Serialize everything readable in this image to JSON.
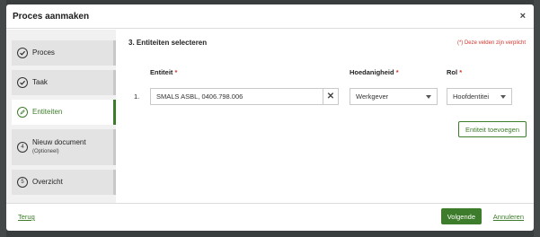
{
  "modal": {
    "title": "Proces aanmaken",
    "close_glyph": "×"
  },
  "sidebar": {
    "steps": [
      {
        "label": "Proces",
        "state": "done",
        "icon": "check-icon"
      },
      {
        "label": "Taak",
        "state": "done",
        "icon": "check-icon"
      },
      {
        "label": "Entiteiten",
        "state": "active",
        "icon": "pencil-icon"
      },
      {
        "label": "Nieuw document",
        "sub": "(Optioneel)",
        "number": "4",
        "state": "todo"
      },
      {
        "label": "Overzicht",
        "number": "5",
        "state": "todo"
      }
    ]
  },
  "content": {
    "section_title": "3. Entiteiten selecteren",
    "required_note": "(*) Deze velden zijn verplicht",
    "columns": {
      "entity": "Entiteit",
      "role_type": "Hoedanigheid",
      "role": "Rol",
      "required_mark": "*"
    },
    "rows": [
      {
        "number": "1.",
        "entity_value": "SMALS ASBL, 0406.798.006",
        "clear_glyph": "✕",
        "role_type_value": "Werkgever",
        "role_value": "Hoofdentitei"
      }
    ],
    "add_button": "Entiteit toevoegen"
  },
  "footer": {
    "back": "Terug",
    "next": "Volgende",
    "cancel": "Annuleren"
  },
  "colors": {
    "accent": "#3d7c2a",
    "required": "#d0342c"
  }
}
